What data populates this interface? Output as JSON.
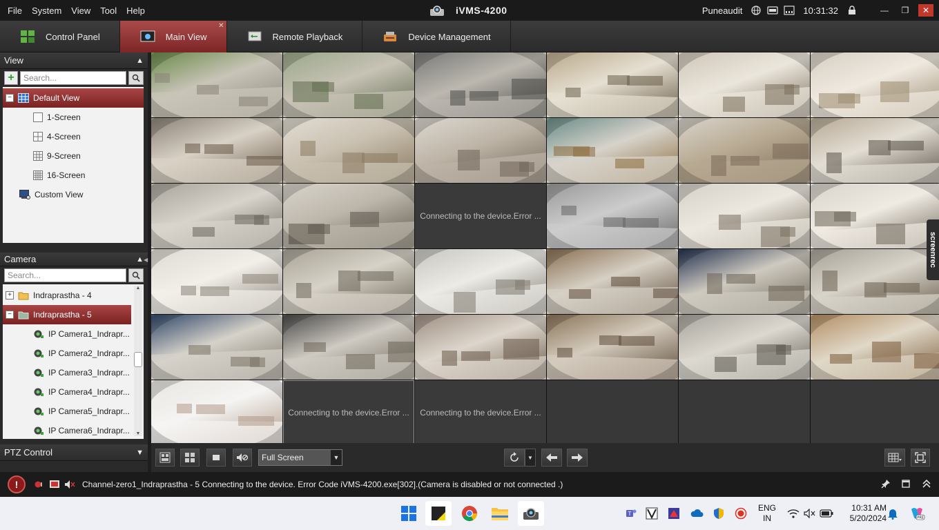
{
  "menu": [
    "File",
    "System",
    "View",
    "Tool",
    "Help"
  ],
  "app": {
    "title": "iVMS-4200",
    "user": "Puneaudit",
    "clock": "10:31:32"
  },
  "tabs": [
    {
      "label": "Control Panel",
      "active": false
    },
    {
      "label": "Main View",
      "active": true
    },
    {
      "label": "Remote Playback",
      "active": false
    },
    {
      "label": "Device Management",
      "active": false
    }
  ],
  "view_panel": {
    "title": "View",
    "search_placeholder": "Search...",
    "items": [
      {
        "label": "Default View",
        "selected": true
      },
      {
        "label": "1-Screen"
      },
      {
        "label": "4-Screen"
      },
      {
        "label": "9-Screen"
      },
      {
        "label": "16-Screen"
      },
      {
        "label": "Custom View"
      }
    ]
  },
  "camera_panel": {
    "title": "Camera",
    "search_placeholder": "Search...",
    "groups": [
      {
        "label": "Indraprastha - 4",
        "expanded": false,
        "selected": false
      },
      {
        "label": "Indraprastha - 5",
        "expanded": true,
        "selected": true
      }
    ],
    "cameras": [
      "IP Camera1_Indrapr...",
      "IP Camera2_Indrapr...",
      "IP Camera3_Indrapr...",
      "IP Camera4_Indrapr...",
      "IP Camera5_Indrapr...",
      "IP Camera6_Indrapr..."
    ]
  },
  "ptz": {
    "title": "PTZ Control"
  },
  "grid": {
    "error_text": "Connecting to the device.Error ...",
    "cells": [
      "video",
      "video",
      "video",
      "video",
      "video",
      "video",
      "video",
      "video",
      "video",
      "video",
      "video",
      "video",
      "video",
      "video",
      "error",
      "video",
      "video",
      "video",
      "video",
      "video",
      "video",
      "video",
      "video",
      "video",
      "video",
      "video",
      "video",
      "video",
      "video",
      "video",
      "video",
      "error",
      "error",
      "empty",
      "empty",
      "empty"
    ]
  },
  "toolbar": {
    "screen_mode": "Full Screen"
  },
  "status": {
    "message": "Channel-zero1_Indraprastha - 5 Connecting to the device. Error Code iVMS-4200.exe[302].(Camera is disabled or not connected .)"
  },
  "overlay": {
    "screenrec": "screenrec"
  },
  "taskbar": {
    "lang_top": "ENG",
    "lang_bottom": "IN",
    "time": "10:31 AM",
    "date": "5/20/2024"
  }
}
